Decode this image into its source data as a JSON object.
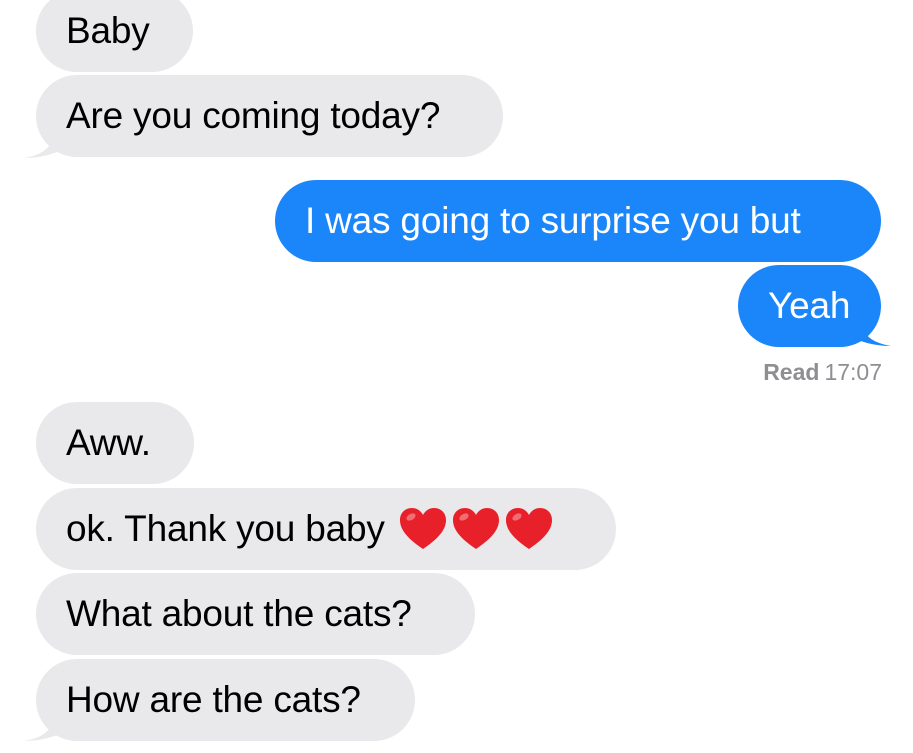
{
  "conversation": {
    "messages": [
      {
        "from": "them",
        "text": "Baby"
      },
      {
        "from": "them",
        "text": "Are you coming today?"
      },
      {
        "from": "me",
        "text": "I was going to surprise you but"
      },
      {
        "from": "me",
        "text": "Yeah"
      },
      {
        "from": "them",
        "text": "Aww."
      },
      {
        "from": "them",
        "text": "ok. Thank you baby",
        "emoji": "heart-icon x3"
      },
      {
        "from": "them",
        "text": "What about the cats?"
      },
      {
        "from": "them",
        "text": "How are the cats?"
      }
    ],
    "read_receipt": {
      "status": "Read",
      "time": "17:07"
    }
  },
  "colors": {
    "incoming_bubble": "#e9e9eb",
    "outgoing_bubble": "#1b86f9",
    "receipt_text": "#8e8e93",
    "heart": "#e8202a"
  }
}
